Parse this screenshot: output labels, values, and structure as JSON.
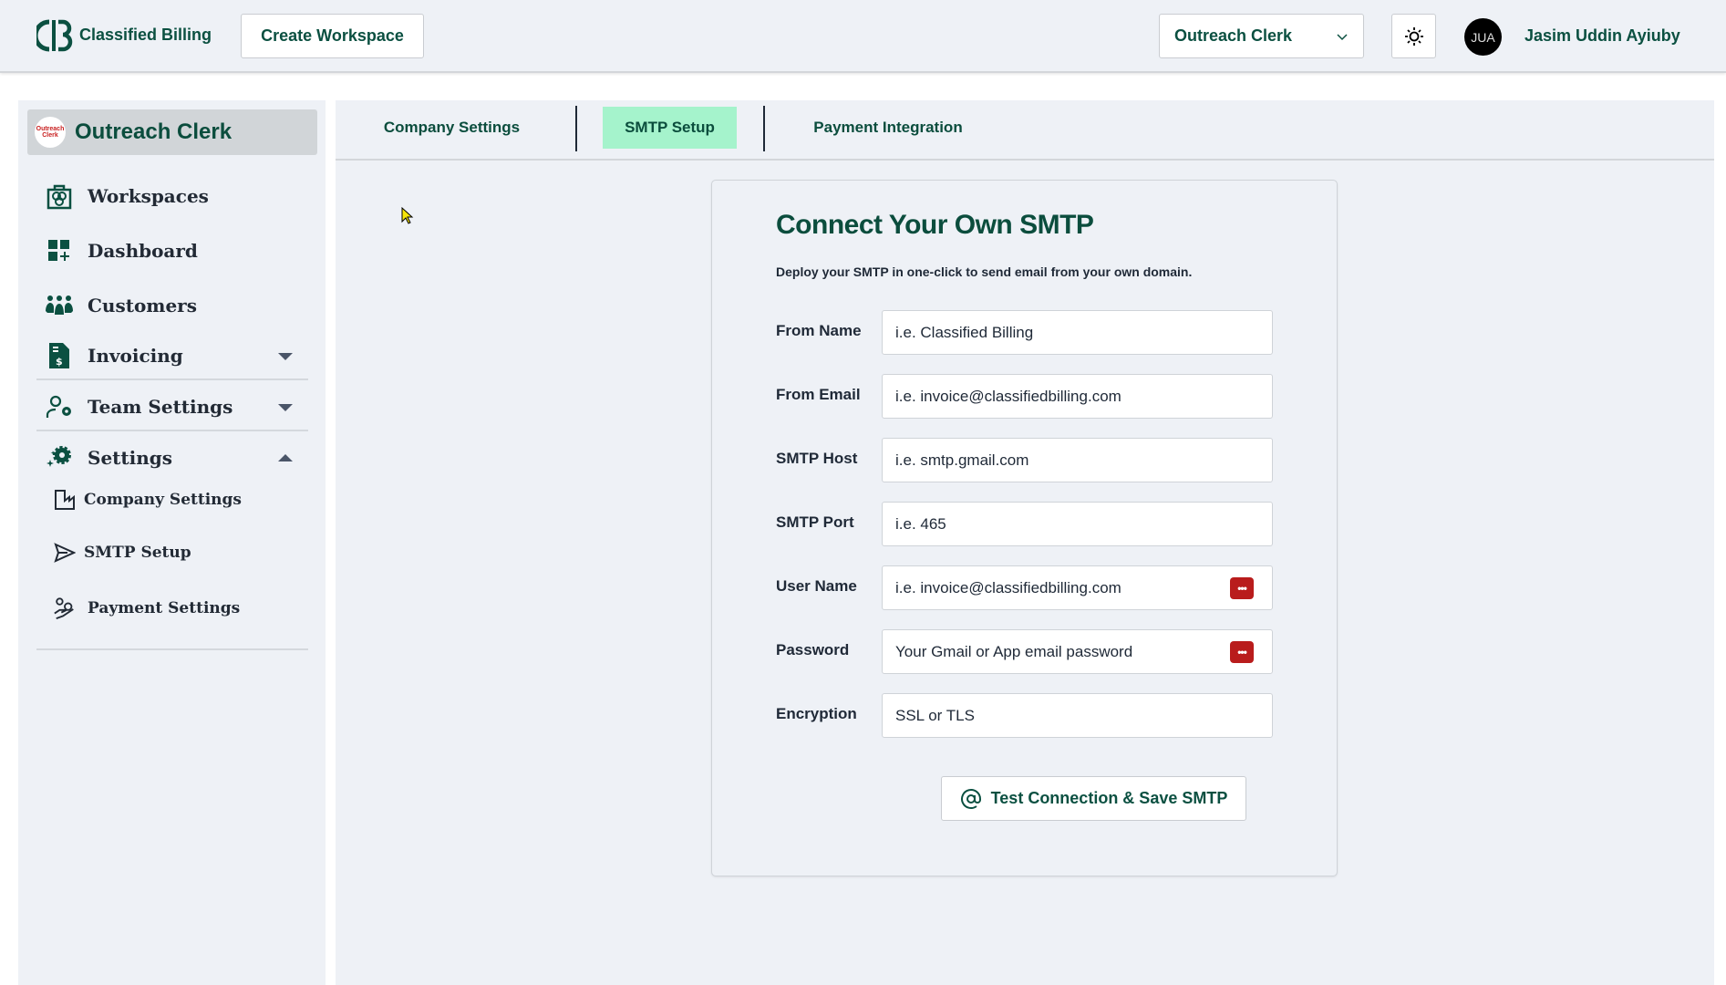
{
  "header": {
    "brand": "Classified Billing",
    "create_workspace": "Create Workspace",
    "workspace_select": "Outreach Clerk",
    "avatar_initials": "JUA",
    "user_name": "Jasim Uddin Ayiuby"
  },
  "sidebar": {
    "org_name": "Outreach Clerk",
    "org_logo_text": "Outreach Clerk",
    "items": [
      {
        "label": "Workspaces",
        "icon": "workspaces-icon"
      },
      {
        "label": "Dashboard",
        "icon": "dashboard-icon"
      },
      {
        "label": "Customers",
        "icon": "customers-icon"
      },
      {
        "label": "Invoicing",
        "icon": "invoice-icon"
      },
      {
        "label": "Team Settings",
        "icon": "team-settings-icon"
      },
      {
        "label": "Settings",
        "icon": "settings-icon"
      }
    ],
    "sub_items": [
      {
        "label": "Company Settings",
        "icon": "factory-icon"
      },
      {
        "label": "SMTP Setup",
        "icon": "send-icon"
      },
      {
        "label": "Payment Settings",
        "icon": "payment-hand-icon"
      }
    ]
  },
  "tabs": [
    {
      "label": "Company Settings"
    },
    {
      "label": "SMTP Setup",
      "active": true
    },
    {
      "label": "Payment Integration"
    }
  ],
  "form": {
    "title": "Connect Your Own SMTP",
    "subtitle": "Deploy your SMTP in one-click to send email from your own domain.",
    "fields": [
      {
        "label": "From Name",
        "placeholder": "i.e. Classified Billing"
      },
      {
        "label": "From Email",
        "placeholder": "i.e. invoice@classifiedbilling.com"
      },
      {
        "label": "SMTP Host",
        "placeholder": "i.e. smtp.gmail.com"
      },
      {
        "label": "SMTP Port",
        "placeholder": "i.e. 465"
      },
      {
        "label": "User Name",
        "placeholder": "i.e. invoice@classifiedbilling.com"
      },
      {
        "label": "Password",
        "placeholder": "Your Gmail or App email password"
      },
      {
        "label": "Encryption",
        "placeholder": "SSL or TLS"
      }
    ],
    "password_manager_glyph": "•••",
    "save_button": "Test Connection & Save SMTP"
  },
  "colors": {
    "brand": "#0b5041",
    "active_tab": "#a5f3cc",
    "background": "#eef1f6",
    "password_badge": "#b91c1c"
  }
}
